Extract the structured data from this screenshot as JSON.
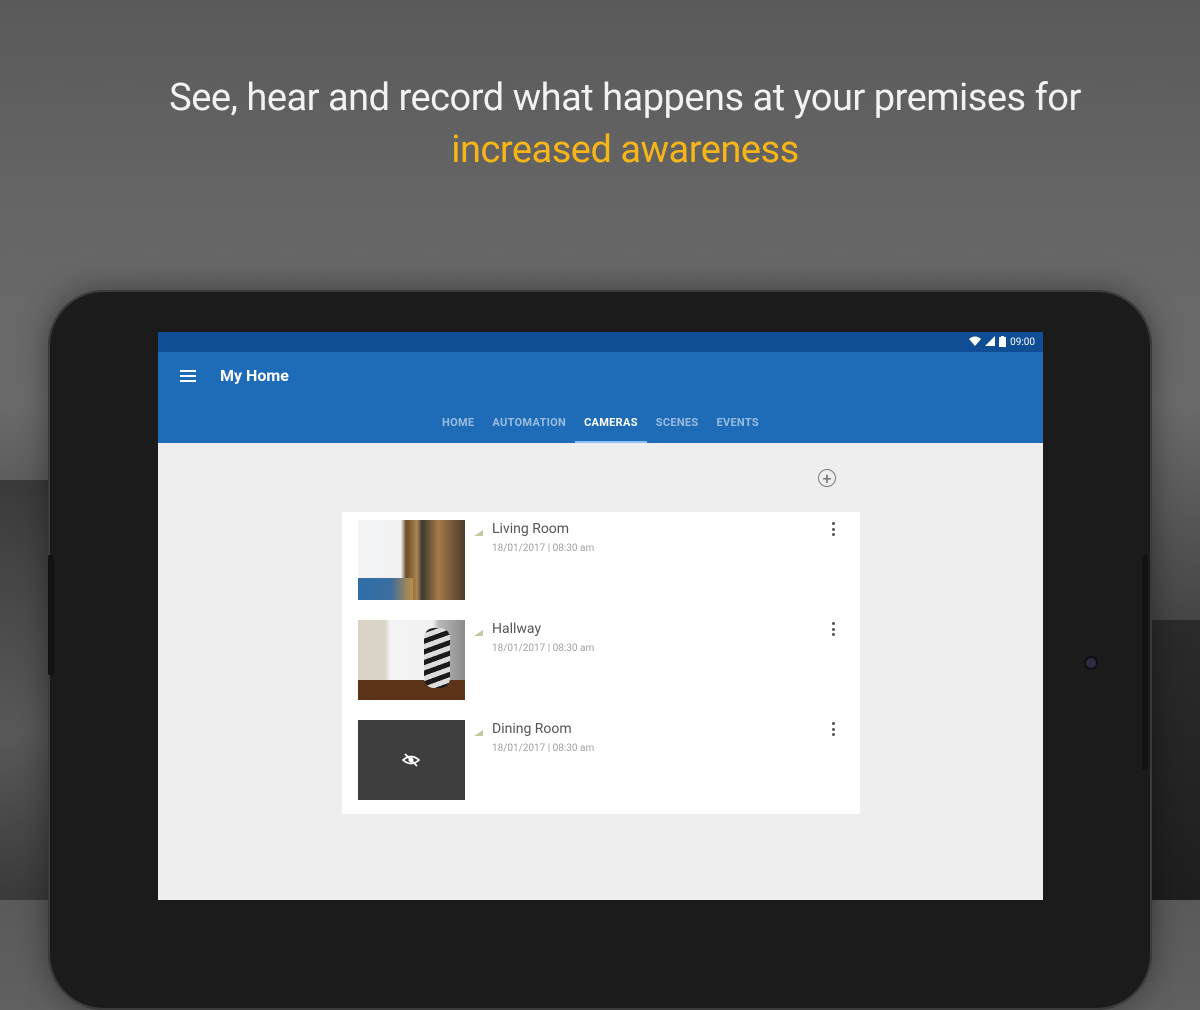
{
  "headline": {
    "line1": "See, hear and record what happens at  your premises for",
    "line2": "increased awareness"
  },
  "colors": {
    "appbar": "#1e6bb8",
    "statusbar": "#0f4e94",
    "accent": "#f7b518"
  },
  "status_bar": {
    "time": "09:00",
    "icons": [
      "wifi-icon",
      "cell-signal-icon",
      "battery-icon"
    ]
  },
  "app": {
    "title": "My Home",
    "tabs": [
      {
        "label": "HOME",
        "active": false
      },
      {
        "label": "AUTOMATION",
        "active": false
      },
      {
        "label": "CAMERAS",
        "active": true
      },
      {
        "label": "SCENES",
        "active": false
      },
      {
        "label": "EVENTS",
        "active": false
      }
    ]
  },
  "cameras": [
    {
      "name": "Living Room",
      "timestamp": "18/01/2017 | 08:30 am",
      "thumbnail": "living-room-photo"
    },
    {
      "name": "Hallway",
      "timestamp": "18/01/2017 | 08:30 am",
      "thumbnail": "hallway-photo"
    },
    {
      "name": "Dining Room",
      "timestamp": "18/01/2017 | 08:30 am",
      "thumbnail": "camera-hidden-icon"
    }
  ]
}
